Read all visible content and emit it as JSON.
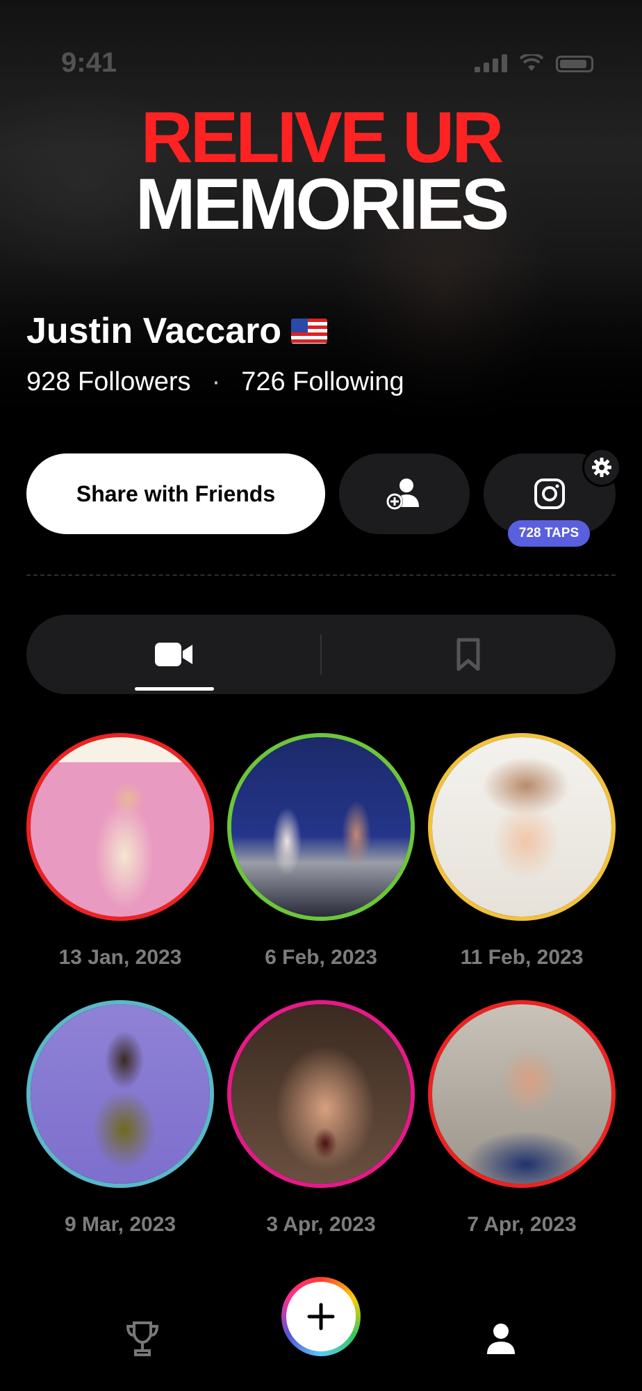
{
  "status_bar": {
    "time": "9:41"
  },
  "hero": {
    "headline_line1": "RELIVE UR",
    "headline_line2": "MEMORIES"
  },
  "profile": {
    "name": "Justin Vaccaro",
    "flag": "us-flag",
    "followers": "928 Followers",
    "separator": "·",
    "following": "726 Following"
  },
  "actions": {
    "share_label": "Share with Friends",
    "add_friend_icon": "add-person-icon",
    "instagram_icon": "instagram-icon",
    "settings_icon": "gear-icon",
    "taps_badge": "728 TAPS",
    "taps_badge_color": "#5a5fe0"
  },
  "tabs": [
    {
      "icon": "video-camera-icon",
      "selected": true
    },
    {
      "icon": "bookmark-icon",
      "selected": false
    }
  ],
  "memories": [
    {
      "date": "13 Jan, 2023",
      "ring_color": "#ee2222",
      "scene": "woman-in-pink-room"
    },
    {
      "date": "6 Feb, 2023",
      "ring_color": "#6cc63b",
      "scene": "wrestling-match"
    },
    {
      "date": "11 Feb, 2023",
      "ring_color": "#f2c23c",
      "scene": "woman-washing-hair"
    },
    {
      "date": "9 Mar, 2023",
      "ring_color": "#5ab8c8",
      "scene": "dancing-woman"
    },
    {
      "date": "3 Apr, 2023",
      "ring_color": "#e6198a",
      "scene": "screaming-man"
    },
    {
      "date": "7 Apr, 2023",
      "ring_color": "#ee2222",
      "scene": "crying-gamer"
    }
  ],
  "bottom_nav": [
    {
      "icon": "trophy-icon"
    },
    {
      "icon": "plus-icon"
    },
    {
      "icon": "profile-icon"
    }
  ]
}
